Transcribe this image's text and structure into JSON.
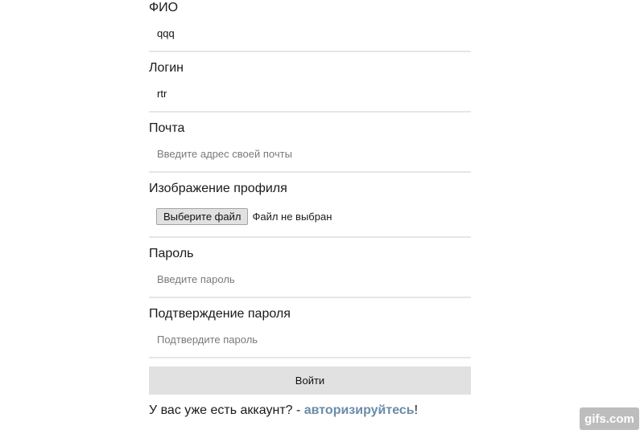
{
  "form": {
    "fio": {
      "label": "ФИО",
      "value": "qqq",
      "placeholder": ""
    },
    "login": {
      "label": "Логин",
      "value": "rtr",
      "placeholder": ""
    },
    "email": {
      "label": "Почта",
      "value": "",
      "placeholder": "Введите адрес своей почты"
    },
    "avatar": {
      "label": "Изображение профиля",
      "button_label": "Выберите файл",
      "status": "Файл не выбран"
    },
    "password": {
      "label": "Пароль",
      "value": "",
      "placeholder": "Введите пароль"
    },
    "password_confirm": {
      "label": "Подтверждение пароля",
      "value": "",
      "placeholder": "Подтвердите пароль"
    },
    "submit_label": "Войти"
  },
  "footer": {
    "prefix": "У вас уже есть аккаунт? - ",
    "link_label": "авторизируйтесь",
    "suffix": "!"
  },
  "watermark": {
    "text": "gifs.com"
  },
  "colors": {
    "link": "#6b8ca8",
    "button_bg": "#e1e1e1",
    "underline": "#e6e6e6"
  }
}
